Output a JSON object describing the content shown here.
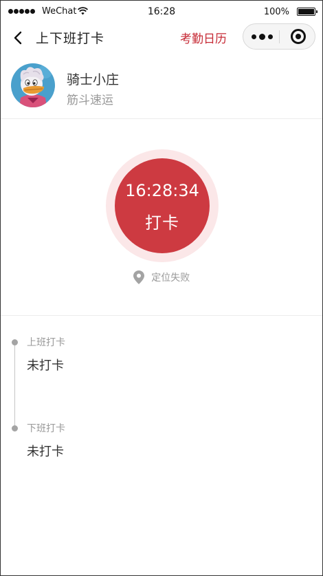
{
  "status_bar": {
    "carrier": "WeChat",
    "time": "16:28",
    "battery": "100%"
  },
  "nav": {
    "title": "上下班打卡",
    "calendar_link": "考勤日历"
  },
  "profile": {
    "name": "骑士小庄",
    "company": "筋斗速运"
  },
  "punch": {
    "time": "16:28:34",
    "label": "打卡",
    "location_status": "定位失败"
  },
  "timeline": [
    {
      "label": "上班打卡",
      "value": "未打卡"
    },
    {
      "label": "下班打卡",
      "value": "未打卡"
    }
  ],
  "colors": {
    "accent_red": "#cd3a41",
    "halo_pink": "#fbe7e8",
    "link_red": "#c62a35"
  }
}
